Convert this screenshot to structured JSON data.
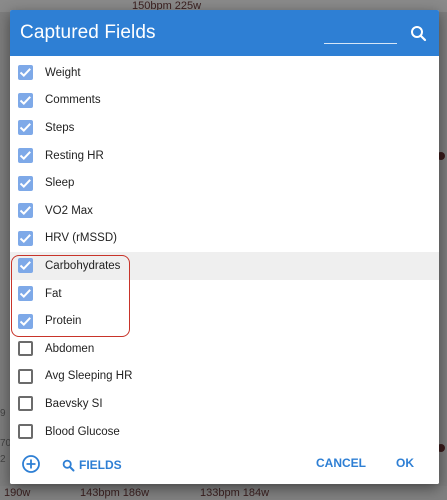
{
  "background": {
    "top_text": "150bpm 225w",
    "bottom_texts": [
      "190w",
      "143bpm 186w",
      "133bpm 184w"
    ],
    "left_edge_texts": [
      "9",
      "70",
      "2"
    ]
  },
  "dialog": {
    "title": "Captured Fields",
    "search_icon": "search-icon",
    "fields": [
      {
        "label": "Weight",
        "checked": true
      },
      {
        "label": "Comments",
        "checked": true
      },
      {
        "label": "Steps",
        "checked": true
      },
      {
        "label": "Resting HR",
        "checked": true
      },
      {
        "label": "Sleep",
        "checked": true
      },
      {
        "label": "VO2 Max",
        "checked": true
      },
      {
        "label": "HRV (rMSSD)",
        "checked": true
      },
      {
        "label": "Carbohydrates",
        "checked": true,
        "highlighted": true
      },
      {
        "label": "Fat",
        "checked": true
      },
      {
        "label": "Protein",
        "checked": true
      },
      {
        "label": "Abdomen",
        "checked": false
      },
      {
        "label": "Avg Sleeping HR",
        "checked": false
      },
      {
        "label": "Baevsky SI",
        "checked": false
      },
      {
        "label": "Blood Glucose",
        "checked": false
      }
    ],
    "footer": {
      "fields_label": "FIELDS",
      "cancel_label": "CANCEL",
      "ok_label": "OK"
    }
  },
  "colors": {
    "accent": "#2e7fd4",
    "checkbox_checked": "#7ea9e8",
    "highlight_row": "#efefef",
    "selection_outline": "#c8342a"
  }
}
